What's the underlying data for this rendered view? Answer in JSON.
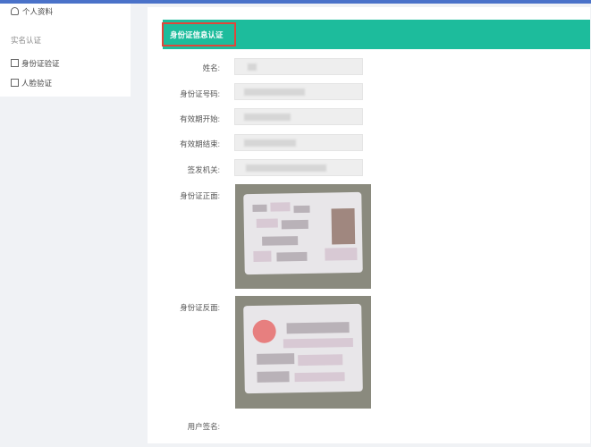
{
  "sidebar": {
    "item_profile": "个人资料",
    "section_auth": "实名认证",
    "item_id_auth": "身份证验证",
    "item_face_auth": "人脸验证"
  },
  "main": {
    "banner_title": "身份证信息认证"
  },
  "form": {
    "name_label": "姓名:",
    "id_number_label": "身份证号码:",
    "valid_start_label": "有效期开始:",
    "valid_end_label": "有效期结束:",
    "issuer_label": "签发机关:",
    "front_label": "身份证正面:",
    "back_label": "身份证反面:",
    "signature_label": "用户签名:"
  },
  "colors": {
    "banner": "#1dbc9c",
    "highlight_box": "#e0463a",
    "topbar": "#4a72c9"
  }
}
